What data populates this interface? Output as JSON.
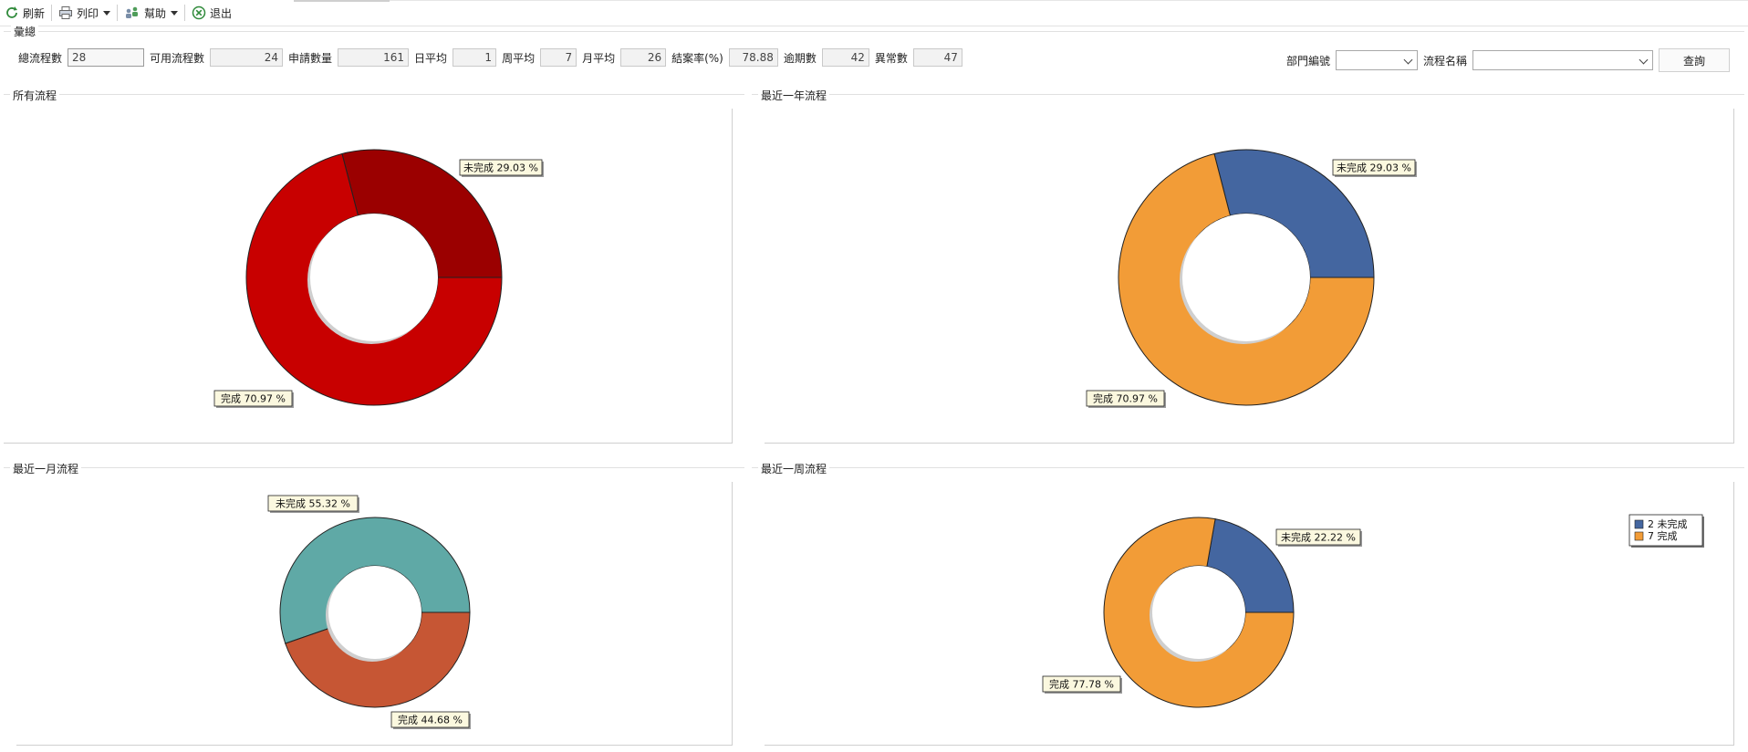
{
  "toolbar": {
    "refresh": "刷新",
    "print": "列印",
    "help": "幫助",
    "exit": "退出"
  },
  "summary": {
    "title": "彙總",
    "fields": [
      {
        "label": "總流程數",
        "value": "28"
      },
      {
        "label": "可用流程數",
        "value": "24"
      },
      {
        "label": "申請數量",
        "value": "161"
      },
      {
        "label": "日平均",
        "value": "1"
      },
      {
        "label": "周平均",
        "value": "7"
      },
      {
        "label": "月平均",
        "value": "26"
      },
      {
        "label": "結案率(%)",
        "value": "78.88"
      },
      {
        "label": "逾期數",
        "value": "42"
      },
      {
        "label": "異常數",
        "value": "47"
      }
    ],
    "filters": {
      "department_label": "部門編號",
      "department_value": "",
      "process_label": "流程名稱",
      "process_value": "",
      "query_button": "查詢"
    }
  },
  "panels": {
    "all": "所有流程",
    "year": "最近一年流程",
    "month": "最近一月流程",
    "week": "最近一周流程"
  },
  "chart_data": [
    {
      "type": "pie",
      "title": "所有流程",
      "categories": [
        "未完成",
        "完成"
      ],
      "values": [
        29.03,
        70.97
      ],
      "labels": [
        "未完成 29.03 %",
        "完成 70.97 %"
      ],
      "colors": [
        "#9b0000",
        "#c80000"
      ]
    },
    {
      "type": "pie",
      "title": "最近一年流程",
      "categories": [
        "未完成",
        "完成"
      ],
      "values": [
        29.03,
        70.97
      ],
      "labels": [
        "未完成 29.03 %",
        "完成 70.97 %"
      ],
      "colors": [
        "#4466a0",
        "#f29c37"
      ]
    },
    {
      "type": "pie",
      "title": "最近一月流程",
      "categories": [
        "未完成",
        "完成"
      ],
      "values": [
        55.32,
        44.68
      ],
      "labels": [
        "未完成 55.32 %",
        "完成 44.68 %"
      ],
      "colors": [
        "#5fa9a6",
        "#c65634"
      ]
    },
    {
      "type": "pie",
      "title": "最近一周流程",
      "categories": [
        "未完成",
        "完成"
      ],
      "values": [
        22.22,
        77.78
      ],
      "labels": [
        "未完成 22.22 %",
        "完成 77.78 %"
      ],
      "colors": [
        "#4466a0",
        "#f29c37"
      ],
      "legend": {
        "position": "top-right",
        "entries": [
          "2 未完成",
          "7 完成"
        ]
      }
    }
  ]
}
